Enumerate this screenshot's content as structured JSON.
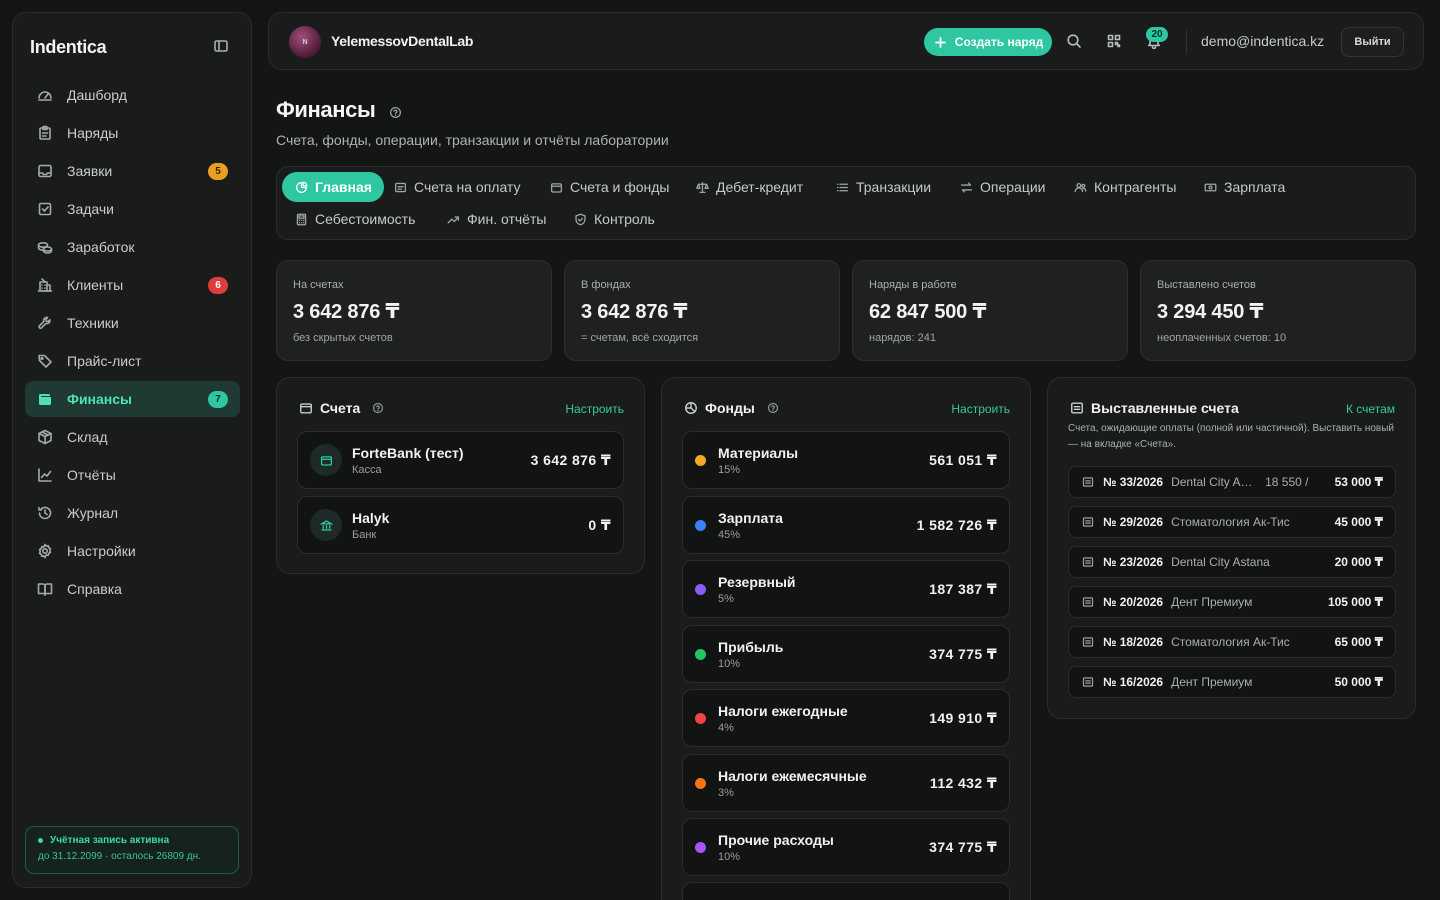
{
  "sidebar": {
    "brand": "Indentica",
    "items": [
      {
        "label": "Дашборд",
        "icon": "gauge-icon"
      },
      {
        "label": "Наряды",
        "icon": "clipboard-icon"
      },
      {
        "label": "Заявки",
        "icon": "inbox-icon",
        "badge": "5",
        "badge_color": "#e8a020"
      },
      {
        "label": "Задачи",
        "icon": "checkbox-icon"
      },
      {
        "label": "Заработок",
        "icon": "coins-icon"
      },
      {
        "label": "Клиенты",
        "icon": "building-icon",
        "badge": "6",
        "badge_color": "#e03c3c"
      },
      {
        "label": "Техники",
        "icon": "wrench-icon"
      },
      {
        "label": "Прайс-лист",
        "icon": "tag-icon"
      },
      {
        "label": "Финансы",
        "icon": "wallet-icon",
        "badge": "7",
        "badge_color": "#2ec7a2",
        "active": true
      },
      {
        "label": "Склад",
        "icon": "box-icon"
      },
      {
        "label": "Отчёты",
        "icon": "chart-icon"
      },
      {
        "label": "Журнал",
        "icon": "history-icon"
      },
      {
        "label": "Настройки",
        "icon": "gear-icon"
      },
      {
        "label": "Справка",
        "icon": "book-icon"
      }
    ],
    "account": {
      "status": "Учётная запись активна",
      "expiry": "до 31.12.2099 · осталось 26809 дн."
    }
  },
  "topbar": {
    "lab_name": "YelemessovDentalLab",
    "avatar_text": "N",
    "create_label": "Создать наряд",
    "notifications": "20",
    "email": "demo@indentica.kz",
    "logout": "Выйти"
  },
  "page": {
    "title": "Финансы",
    "subtitle": "Счета, фонды, операции, транзакции и отчёты лаборатории"
  },
  "tabs": [
    {
      "label": "Главная",
      "icon": "pie-icon",
      "active": true
    },
    {
      "label": "Счета на оплату",
      "icon": "receipt-icon"
    },
    {
      "label": "Счета и фонды",
      "icon": "wallet-icon"
    },
    {
      "label": "Дебет-кредит",
      "icon": "scale-icon"
    },
    {
      "label": "Транзакции",
      "icon": "list-icon"
    },
    {
      "label": "Операции",
      "icon": "arrows-icon"
    },
    {
      "label": "Контрагенты",
      "icon": "users-icon"
    },
    {
      "label": "Зарплата",
      "icon": "cash-icon"
    },
    {
      "label": "Себестоимость",
      "icon": "calculator-icon"
    },
    {
      "label": "Фин. отчёты",
      "icon": "trend-icon"
    },
    {
      "label": "Контроль",
      "icon": "shield-icon"
    }
  ],
  "stats": [
    {
      "title": "На счетах",
      "value": "3 642 876 ₸",
      "note": "без скрытых счетов"
    },
    {
      "title": "В фондах",
      "value": "3 642 876 ₸",
      "note": "= счетам, всё сходится"
    },
    {
      "title": "Наряды в работе",
      "value": "62 847 500 ₸",
      "note": "нарядов: 241"
    },
    {
      "title": "Выставлено счетов",
      "value": "3 294 450 ₸",
      "note": "неоплаченных счетов: 10"
    }
  ],
  "accounts_panel": {
    "title": "Счета",
    "link": "Настроить",
    "items": [
      {
        "name": "ForteBank (тест)",
        "type": "Касса",
        "amount": "3 642 876 ₸",
        "icon": "wallet-icon"
      },
      {
        "name": "Halyk",
        "type": "Банк",
        "amount": "0 ₸",
        "icon": "bank-icon"
      }
    ]
  },
  "funds_panel": {
    "title": "Фонды",
    "link": "Настроить",
    "items": [
      {
        "name": "Материалы",
        "pct": "15%",
        "amount": "561 051 ₸",
        "color": "#f5a623"
      },
      {
        "name": "Зарплата",
        "pct": "45%",
        "amount": "1 582 726 ₸",
        "color": "#3b82f6"
      },
      {
        "name": "Резервный",
        "pct": "5%",
        "amount": "187 387 ₸",
        "color": "#8b5cf6"
      },
      {
        "name": "Прибыль",
        "pct": "10%",
        "amount": "374 775 ₸",
        "color": "#22c55e"
      },
      {
        "name": "Налоги ежегодные",
        "pct": "4%",
        "amount": "149 910 ₸",
        "color": "#ef4444"
      },
      {
        "name": "Налоги ежемесячные",
        "pct": "3%",
        "amount": "112 432 ₸",
        "color": "#f97316"
      },
      {
        "name": "Прочие расходы",
        "pct": "10%",
        "amount": "374 775 ₸",
        "color": "#a855f7"
      }
    ]
  },
  "invoices_panel": {
    "title": "Выставленные счета",
    "link": "К счетам",
    "description": "Счета, ожидающие оплаты (полной или частичной). Выставить новый — на вкладке «Счета».",
    "items": [
      {
        "number": "№ 33/2026",
        "client": "Dental City Astana",
        "paid": "18 550 /",
        "amount": "53 000 ₸"
      },
      {
        "number": "№ 29/2026",
        "client": "Стоматология Ак-Тис",
        "paid": "",
        "amount": "45 000 ₸"
      },
      {
        "number": "№ 23/2026",
        "client": "Dental City Astana",
        "paid": "",
        "amount": "20 000 ₸"
      },
      {
        "number": "№ 20/2026",
        "client": "Дент Премиум",
        "paid": "",
        "amount": "105 000 ₸"
      },
      {
        "number": "№ 18/2026",
        "client": "Стоматология Ак-Тис",
        "paid": "",
        "amount": "65 000 ₸"
      },
      {
        "number": "№ 16/2026",
        "client": "Дент Премиум",
        "paid": "",
        "amount": "50 000 ₸"
      }
    ]
  }
}
